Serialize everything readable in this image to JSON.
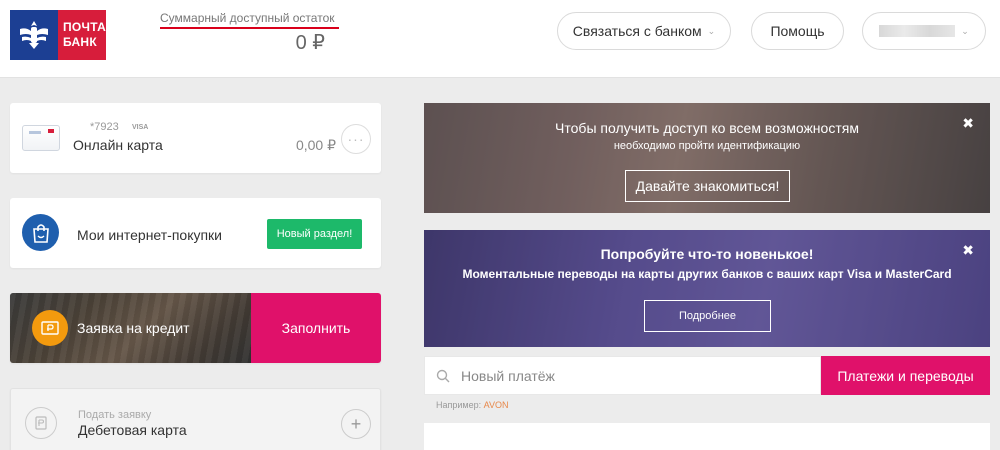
{
  "header": {
    "logo": {
      "line1": "ПОЧТА",
      "line2": "БАНК"
    },
    "balance_title": "Суммарный доступный остаток",
    "balance_value": "0 ₽",
    "contact_bank_label": "Связаться с банком",
    "help_label": "Помощь"
  },
  "products": {
    "card": {
      "number": "*7923",
      "system": "VISA",
      "name": "Онлайн карта",
      "amount": "0,00 ₽",
      "menu_icon": "more-dots-icon"
    },
    "purchases": {
      "label": "Мои интернет-покупки",
      "badge": "Новый раздел!",
      "icon": "shopping-bag-icon"
    },
    "credit": {
      "label": "Заявка на кредит",
      "action": "Заполнить",
      "icon": "ruble-coin-icon"
    },
    "debit": {
      "small_label": "Подать заявку",
      "label": "Дебетовая карта",
      "icon": "document-icon"
    }
  },
  "banners": {
    "identify": {
      "title": "Чтобы получить доступ ко всем возможностям",
      "subtitle": "необходимо пройти идентификацию",
      "button": "Давайте знакомиться!"
    },
    "promo": {
      "title": "Попробуйте что-то новенькое!",
      "subtitle": "Моментальные переводы на карты других банков с ваших карт Visa и MasterCard",
      "button": "Подробнее"
    }
  },
  "payments": {
    "search_placeholder": "Новый платёж",
    "button": "Платежи и переводы",
    "example_prefix": "Например:",
    "example_link": "AVON"
  },
  "colors": {
    "brand_blue": "#1c3f93",
    "brand_red": "#d71d3b",
    "accent_pink": "#e0116a",
    "badge_green": "#1db96a"
  }
}
